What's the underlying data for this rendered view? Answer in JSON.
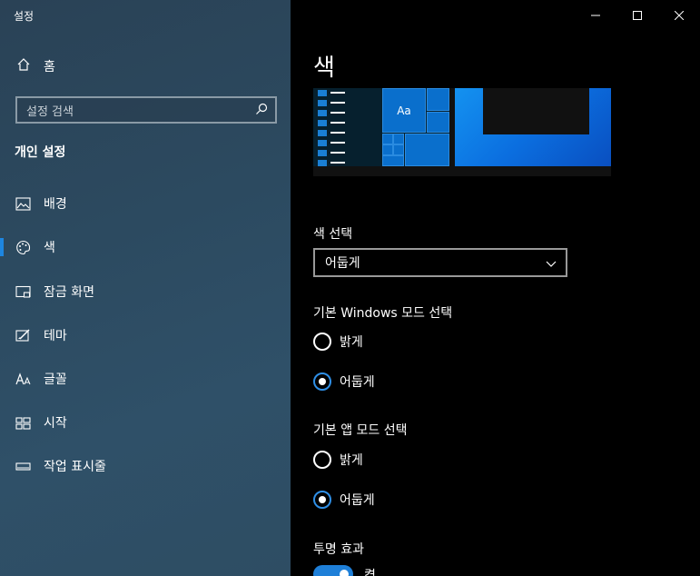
{
  "app": {
    "title": "설정"
  },
  "sidebar": {
    "home_label": "홈",
    "search_placeholder": "설정 검색",
    "section_title": "개인 설정",
    "items": [
      {
        "label": "배경",
        "icon": "image-icon"
      },
      {
        "label": "색",
        "icon": "palette-icon",
        "selected": true
      },
      {
        "label": "잠금 화면",
        "icon": "lock-screen-icon"
      },
      {
        "label": "테마",
        "icon": "theme-icon"
      },
      {
        "label": "글꼴",
        "icon": "font-icon"
      },
      {
        "label": "시작",
        "icon": "start-icon"
      },
      {
        "label": "작업 표시줄",
        "icon": "taskbar-icon"
      }
    ]
  },
  "main": {
    "title": "색",
    "preview": {
      "tile_text": "Aa"
    },
    "color_select": {
      "label": "색 선택",
      "value": "어둡게"
    },
    "windows_mode": {
      "label": "기본 Windows 모드 선택",
      "options": [
        {
          "label": "밝게",
          "checked": false
        },
        {
          "label": "어둡게",
          "checked": true
        }
      ]
    },
    "app_mode": {
      "label": "기본 앱 모드 선택",
      "options": [
        {
          "label": "밝게",
          "checked": false
        },
        {
          "label": "어둡게",
          "checked": true
        }
      ]
    },
    "transparency": {
      "label": "투명 효과",
      "toggle_label": "켬",
      "on": true
    }
  },
  "colors": {
    "accent": "#1e86e0",
    "sidebar_bg": "#2c4a60",
    "main_bg": "#000000"
  }
}
